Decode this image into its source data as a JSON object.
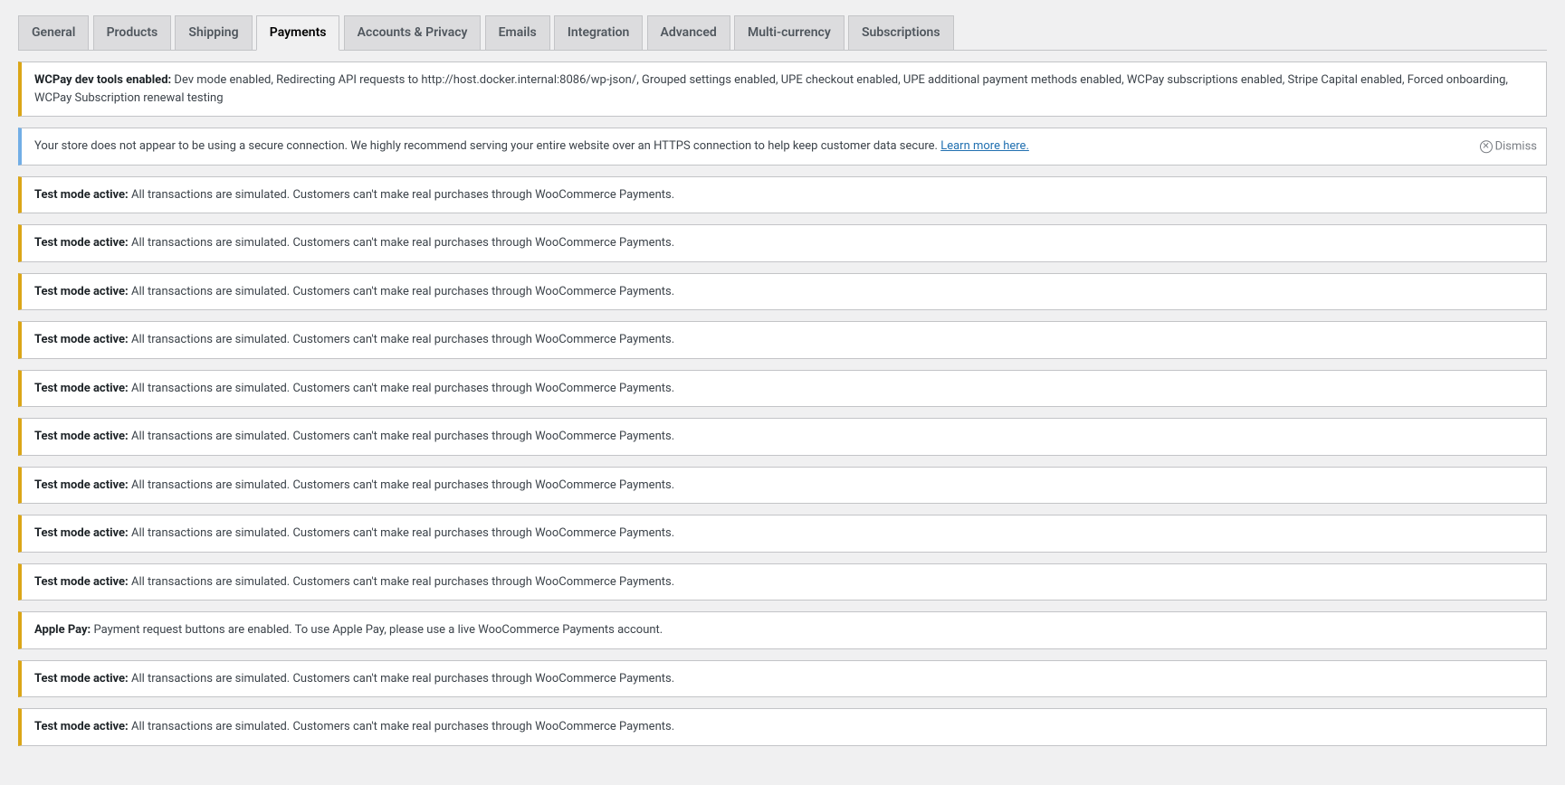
{
  "tabs": [
    {
      "label": "General",
      "active": false
    },
    {
      "label": "Products",
      "active": false
    },
    {
      "label": "Shipping",
      "active": false
    },
    {
      "label": "Payments",
      "active": true
    },
    {
      "label": "Accounts & Privacy",
      "active": false
    },
    {
      "label": "Emails",
      "active": false
    },
    {
      "label": "Integration",
      "active": false
    },
    {
      "label": "Advanced",
      "active": false
    },
    {
      "label": "Multi-currency",
      "active": false
    },
    {
      "label": "Subscriptions",
      "active": false
    }
  ],
  "devtools_notice": {
    "title": "WCPay dev tools enabled:",
    "text": "Dev mode enabled, Redirecting API requests to http://host.docker.internal:8086/wp-json/, Grouped settings enabled, UPE checkout enabled, UPE additional payment methods enabled, WCPay subscriptions enabled, Stripe Capital enabled, Forced onboarding, WCPay Subscription renewal testing"
  },
  "https_notice": {
    "text": "Your store does not appear to be using a secure connection. We highly recommend serving your entire website over an HTTPS connection to help keep customer data secure. ",
    "link_text": "Learn more here.",
    "dismiss_label": "Dismiss"
  },
  "notices": [
    {
      "title": "Test mode active:",
      "text": "All transactions are simulated. Customers can't make real purchases through WooCommerce Payments."
    },
    {
      "title": "Test mode active:",
      "text": "All transactions are simulated. Customers can't make real purchases through WooCommerce Payments."
    },
    {
      "title": "Test mode active:",
      "text": "All transactions are simulated. Customers can't make real purchases through WooCommerce Payments."
    },
    {
      "title": "Test mode active:",
      "text": "All transactions are simulated. Customers can't make real purchases through WooCommerce Payments."
    },
    {
      "title": "Test mode active:",
      "text": "All transactions are simulated. Customers can't make real purchases through WooCommerce Payments."
    },
    {
      "title": "Test mode active:",
      "text": "All transactions are simulated. Customers can't make real purchases through WooCommerce Payments."
    },
    {
      "title": "Test mode active:",
      "text": "All transactions are simulated. Customers can't make real purchases through WooCommerce Payments."
    },
    {
      "title": "Test mode active:",
      "text": "All transactions are simulated. Customers can't make real purchases through WooCommerce Payments."
    },
    {
      "title": "Test mode active:",
      "text": "All transactions are simulated. Customers can't make real purchases through WooCommerce Payments."
    },
    {
      "title": "Apple Pay:",
      "text": "Payment request buttons are enabled. To use Apple Pay, please use a live WooCommerce Payments account."
    },
    {
      "title": "Test mode active:",
      "text": "All transactions are simulated. Customers can't make real purchases through WooCommerce Payments."
    },
    {
      "title": "Test mode active:",
      "text": "All transactions are simulated. Customers can't make real purchases through WooCommerce Payments."
    }
  ]
}
